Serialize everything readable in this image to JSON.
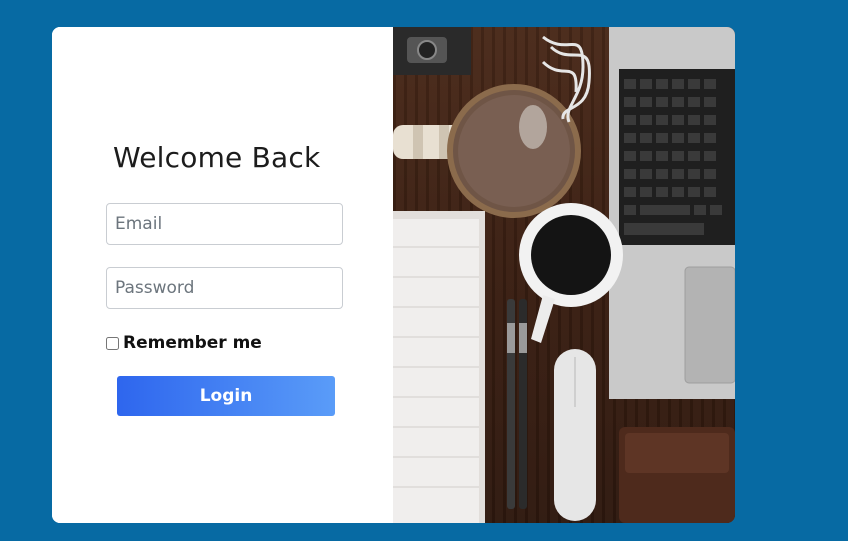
{
  "login": {
    "title": "Welcome Back",
    "email_placeholder": "Email",
    "password_placeholder": "Password",
    "remember_label": "Remember me",
    "remember_checked": false,
    "login_label": "Login"
  },
  "colors": {
    "page_background": "#076aa3",
    "card_background": "#ffffff",
    "button_gradient_start": "#2e66ee",
    "button_gradient_end": "#5a9cf8"
  },
  "photo": {
    "subject": "desk-flatlay-icon"
  }
}
